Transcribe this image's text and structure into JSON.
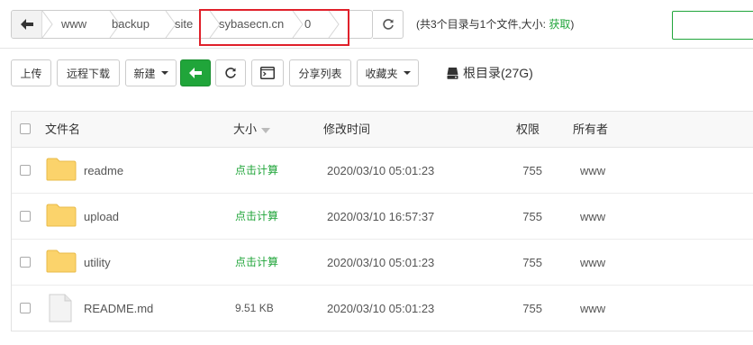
{
  "breadcrumb": {
    "items": [
      "www",
      "backup",
      "site",
      "sybasecn.cn",
      "0"
    ]
  },
  "dir_info": {
    "text": "(共3个目录与1个文件,大小: ",
    "fetch_label": "获取",
    "close": ")"
  },
  "search": {
    "value": ""
  },
  "toolbar": {
    "upload": "上传",
    "remote_download": "远程下载",
    "new": "新建",
    "share_list": "分享列表",
    "favorites": "收藏夹",
    "root_dir": "根目录(27G)"
  },
  "table": {
    "headers": {
      "name": "文件名",
      "size": "大小",
      "mtime": "修改时间",
      "perm": "权限",
      "owner": "所有者"
    },
    "rows": [
      {
        "type": "folder",
        "name": "readme",
        "size": "点击计算",
        "mtime": "2020/03/10 05:01:23",
        "perm": "755",
        "owner": "www"
      },
      {
        "type": "folder",
        "name": "upload",
        "size": "点击计算",
        "mtime": "2020/03/10 16:57:37",
        "perm": "755",
        "owner": "www"
      },
      {
        "type": "folder",
        "name": "utility",
        "size": "点击计算",
        "mtime": "2020/03/10 05:01:23",
        "perm": "755",
        "owner": "www"
      },
      {
        "type": "file",
        "name": "README.md",
        "size": "9.51 KB",
        "mtime": "2020/03/10 05:01:23",
        "perm": "755",
        "owner": "www"
      }
    ]
  },
  "colors": {
    "accent": "#20a53a",
    "highlight": "#e0202a"
  },
  "icons": {
    "back": "arrow-left-icon",
    "refresh": "refresh-icon",
    "terminal": "terminal-icon",
    "disk": "disk-icon",
    "folder": "folder-icon",
    "file": "file-icon"
  }
}
